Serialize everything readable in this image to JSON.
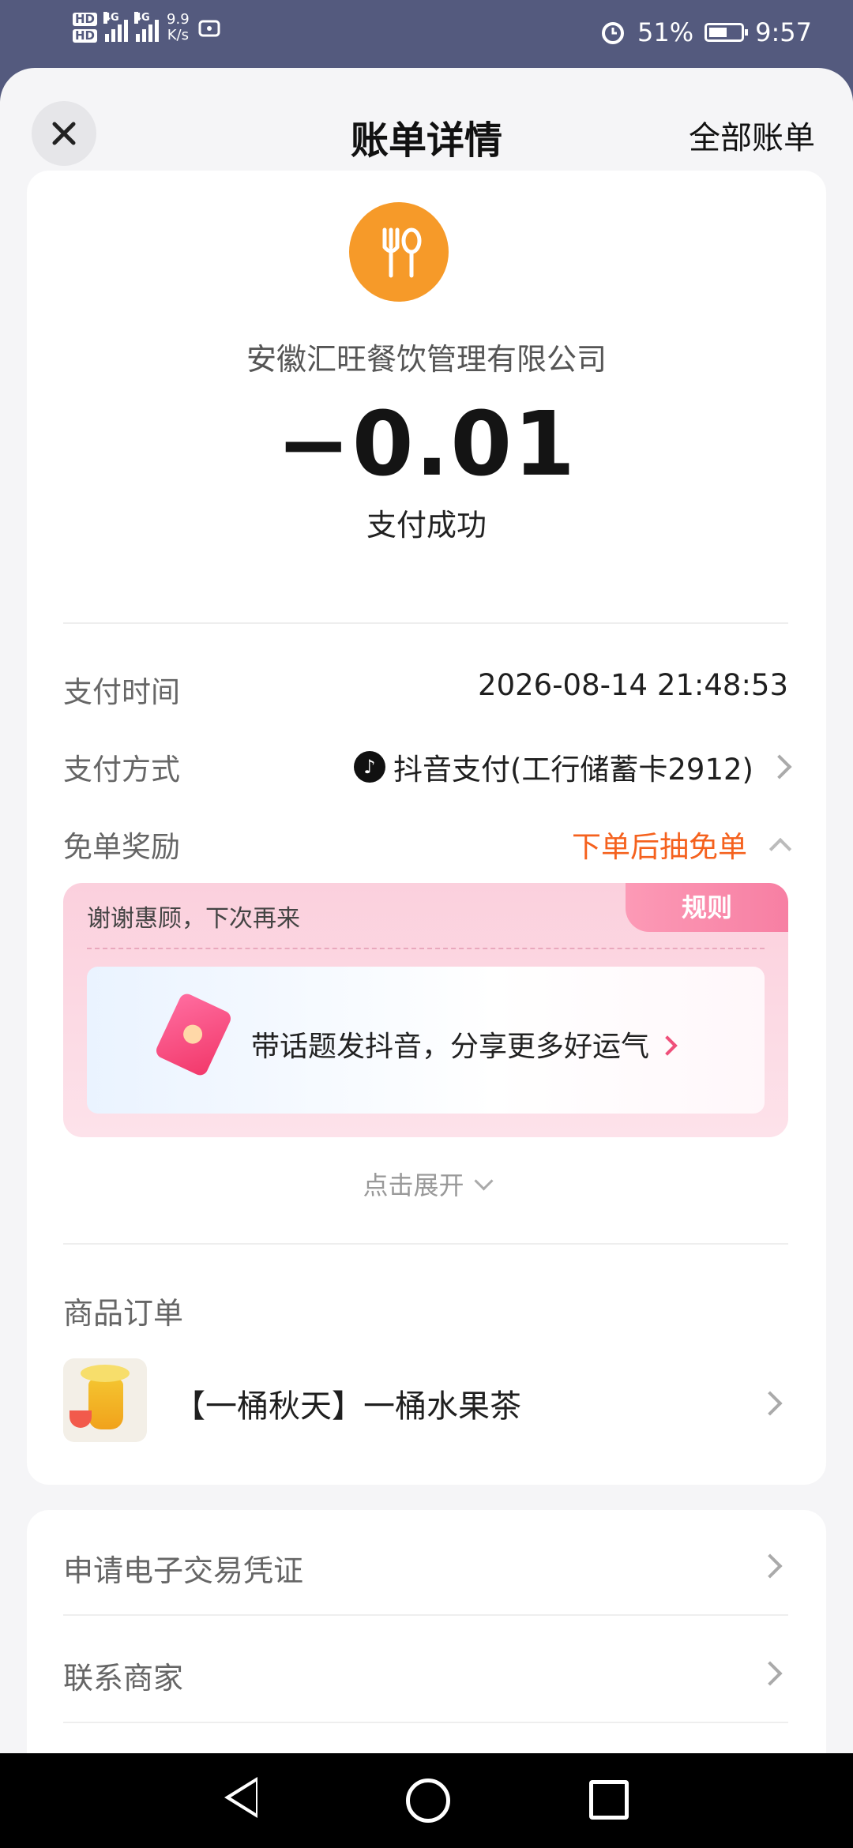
{
  "status_bar": {
    "network_speed_value": "9.9",
    "network_speed_unit": "K/s",
    "battery_percent": "51%",
    "time": "9:57",
    "icons": [
      "hd-icon",
      "signal-4g-icon",
      "tiktok-notification-icon",
      "alarm-icon",
      "battery-charging-icon"
    ]
  },
  "header": {
    "title": "账单详情",
    "right_link": "全部账单",
    "close_icon": "close-icon"
  },
  "merchant": {
    "icon": "fork-spoon-icon",
    "icon_color": "#f69a29",
    "name": "安徽汇旺餐饮管理有限公司"
  },
  "payment": {
    "amount": "−0.01",
    "status": "支付成功"
  },
  "details": {
    "time_label": "支付时间",
    "time_value": "2026-08-14 21:48:53",
    "method_label": "支付方式",
    "method_value": "抖音支付(工行储蓄卡2912)",
    "reward_label": "免单奖励",
    "reward_value": "下单后抽免单"
  },
  "reward_card": {
    "thanks_text": "谢谢惠顾，下次再来",
    "rules_label": "规则",
    "share_text": "带话题发抖音，分享更多好运气"
  },
  "expand_label": "点击展开",
  "order": {
    "section_title": "商品订单",
    "item_name": "【一桶秋天】一桶水果茶"
  },
  "links": {
    "voucher": "申请电子交易凭证",
    "contact": "联系商家"
  },
  "colors": {
    "accent_orange": "#f5611d",
    "reward_pink": "#f77fa3"
  }
}
